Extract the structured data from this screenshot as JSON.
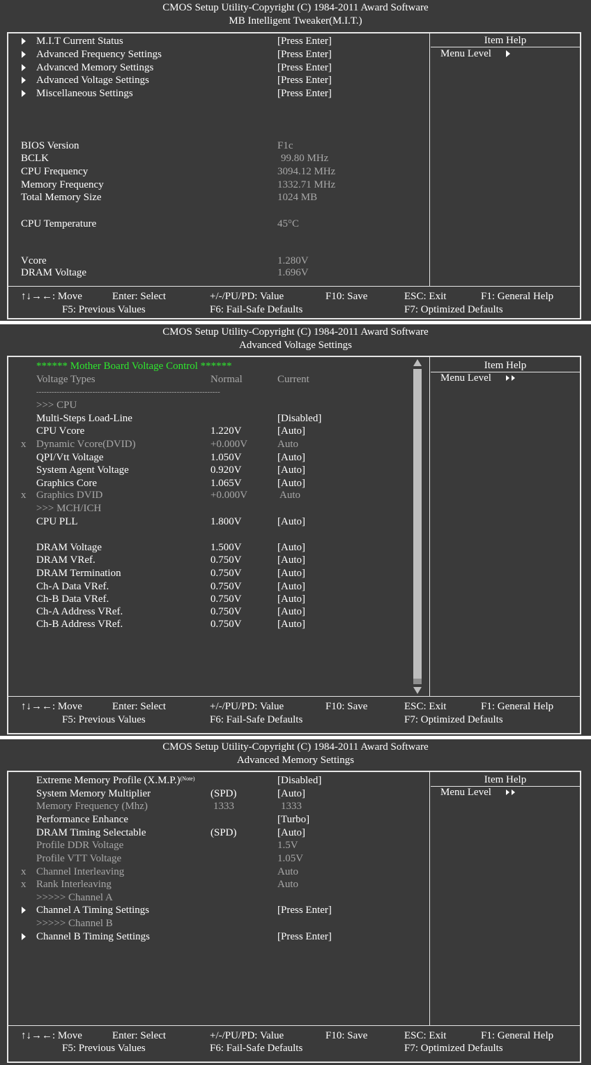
{
  "screen1": {
    "title": "CMOS Setup Utility-Copyright (C) 1984-2011 Award Software",
    "subtitle": "MB Intelligent Tweaker(M.I.T.)",
    "menu": [
      {
        "label": "M.I.T Current Status",
        "value": "[Press Enter]"
      },
      {
        "label": "Advanced Frequency Settings",
        "value": "[Press Enter]"
      },
      {
        "label": "Advanced Memory Settings",
        "value": "[Press Enter]"
      },
      {
        "label": "Advanced Voltage Settings",
        "value": "[Press Enter]"
      },
      {
        "label": "Miscellaneous Settings",
        "value": "[Press Enter]"
      }
    ],
    "info": [
      {
        "label": "BIOS Version",
        "value": "F1c"
      },
      {
        "label": "BCLK",
        "value": "99.80 MHz"
      },
      {
        "label": "CPU Frequency",
        "value": "3094.12 MHz"
      },
      {
        "label": "Memory Frequency",
        "value": "1332.71 MHz"
      },
      {
        "label": "Total Memory Size",
        "value": "1024 MB"
      },
      {
        "label": "CPU Temperature",
        "value": "45°C"
      },
      {
        "label": "Vcore",
        "value": "1.280V"
      },
      {
        "label": "DRAM Voltage",
        "value": "1.696V"
      }
    ],
    "help_title": "Item Help",
    "menu_level": "Menu Level"
  },
  "screen2": {
    "title": "CMOS Setup Utility-Copyright (C) 1984-2011 Award Software",
    "subtitle": "Advanced Voltage Settings",
    "heading": "****** Mother Board Voltage Control ******",
    "col_type": "Voltage Types",
    "col_normal": "Normal",
    "col_current": "Current",
    "divider": "------------------------------------------------------------------------",
    "cpu_section": ">>> CPU",
    "mch_section": ">>> MCH/ICH",
    "rows": [
      {
        "mark": "",
        "label": "Multi-Steps Load-Line",
        "normal": "",
        "current": "[Disabled]",
        "disabled": false
      },
      {
        "mark": "",
        "label": "CPU Vcore",
        "normal": "1.220V",
        "current": "[Auto]",
        "disabled": false
      },
      {
        "mark": "x",
        "label": "Dynamic Vcore(DVID)",
        "normal": "+0.000V",
        "current": "Auto",
        "disabled": true
      },
      {
        "mark": "",
        "label": "QPI/Vtt Voltage",
        "normal": "1.050V",
        "current": "[Auto]",
        "disabled": false
      },
      {
        "mark": "",
        "label": "System Agent Voltage",
        "normal": "0.920V",
        "current": "[Auto]",
        "disabled": false
      },
      {
        "mark": "",
        "label": "Graphics Core",
        "normal": "1.065V",
        "current": "[Auto]",
        "disabled": false
      },
      {
        "mark": "x",
        "label": "Graphics DVID",
        "normal": "+0.000V",
        "current": "Auto",
        "disabled": true
      },
      {
        "mark": "",
        "label": "CPU PLL",
        "normal": "1.800V",
        "current": "[Auto]",
        "disabled": false
      },
      {
        "mark": "",
        "label": "DRAM Voltage",
        "normal": "1.500V",
        "current": "[Auto]",
        "disabled": false
      },
      {
        "mark": "",
        "label": "DRAM VRef.",
        "normal": "0.750V",
        "current": "[Auto]",
        "disabled": false
      },
      {
        "mark": "",
        "label": "DRAM Termination",
        "normal": "0.750V",
        "current": "[Auto]",
        "disabled": false
      },
      {
        "mark": "",
        "label": "Ch-A Data VRef.",
        "normal": "0.750V",
        "current": "[Auto]",
        "disabled": false
      },
      {
        "mark": "",
        "label": "Ch-B Data VRef.",
        "normal": "0.750V",
        "current": "[Auto]",
        "disabled": false
      },
      {
        "mark": "",
        "label": "Ch-A Address VRef.",
        "normal": "0.750V",
        "current": "[Auto]",
        "disabled": false
      },
      {
        "mark": "",
        "label": "Ch-B Address VRef.",
        "normal": "0.750V",
        "current": "[Auto]",
        "disabled": false
      }
    ],
    "help_title": "Item Help",
    "menu_level": "Menu Level"
  },
  "screen3": {
    "title": "CMOS Setup Utility-Copyright (C) 1984-2011 Award Software",
    "subtitle": "Advanced Memory Settings",
    "xmp_label": "Extreme Memory Profile (X.M.P.)",
    "xmp_note": "(Note)",
    "rows": [
      {
        "mark": "",
        "label": "Extreme Memory Profile (X.M.P.)",
        "mid": "",
        "value": "[Disabled]",
        "disabled": false
      },
      {
        "mark": "",
        "label": "System Memory Multiplier",
        "mid": "(SPD)",
        "value": "[Auto]",
        "disabled": false
      },
      {
        "mark": "",
        "label": "Memory Frequency (Mhz)",
        "mid": "1333",
        "value": "1333",
        "disabled": true
      },
      {
        "mark": "",
        "label": "Performance Enhance",
        "mid": "",
        "value": "[Turbo]",
        "disabled": false
      },
      {
        "mark": "",
        "label": "DRAM Timing Selectable",
        "mid": "(SPD)",
        "value": "[Auto]",
        "disabled": false
      },
      {
        "mark": "",
        "label": "Profile DDR Voltage",
        "mid": "",
        "value": "1.5V",
        "disabled": true
      },
      {
        "mark": "",
        "label": "Profile VTT Voltage",
        "mid": "",
        "value": "1.05V",
        "disabled": true
      },
      {
        "mark": "x",
        "label": "Channel Interleaving",
        "mid": "",
        "value": "Auto",
        "disabled": true
      },
      {
        "mark": "x",
        "label": "Rank Interleaving",
        "mid": "",
        "value": "Auto",
        "disabled": true
      }
    ],
    "channel_a_header": ">>>>> Channel A",
    "channel_a_item": {
      "label": "Channel A Timing Settings",
      "value": "[Press Enter]"
    },
    "channel_b_header": ">>>>> Channel B",
    "channel_b_item": {
      "label": "Channel B Timing Settings",
      "value": "[Press Enter]"
    },
    "help_title": "Item Help",
    "menu_level": "Menu Level"
  },
  "footer": {
    "move": "↑↓→←: Move",
    "select": "Enter: Select",
    "value": "+/-/PU/PD: Value",
    "save": "F10: Save",
    "exit": "ESC: Exit",
    "help": "F1: General Help",
    "prev": "F5: Previous Values",
    "failsafe": "F6: Fail-Safe Defaults",
    "optimized": "F7: Optimized Defaults"
  },
  "colors": {
    "background": "#3a3a3a",
    "text": "#ffffff",
    "disabled_text": "#a8a8a8",
    "heading_green": "#2ee82e",
    "border": "#e6e6e6"
  }
}
